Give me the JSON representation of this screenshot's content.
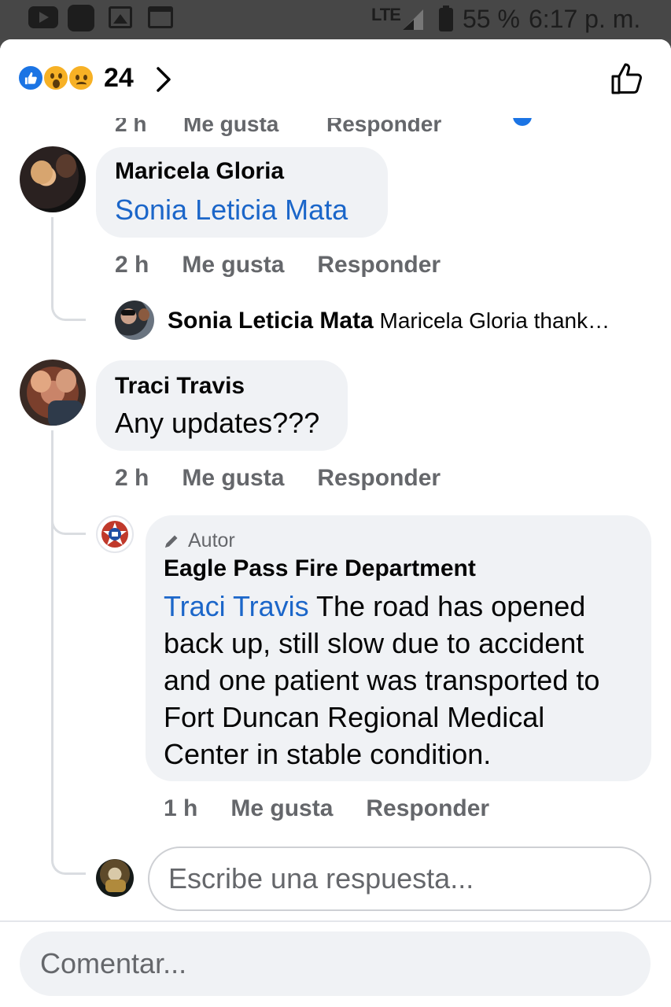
{
  "status_bar": {
    "network": "LTE",
    "battery": "55 %",
    "time": "6:17 p. m.",
    "icons": [
      "youtube-icon",
      "app-icon",
      "gallery-icon",
      "calendar-icon",
      "signal-icon",
      "battery-icon"
    ]
  },
  "reactions": {
    "count": "24",
    "types": [
      "like",
      "wow",
      "sad"
    ],
    "colors": {
      "like": "#1b74e4",
      "emoji": "#f7b125"
    }
  },
  "cut_off_row": {
    "time": "2 h",
    "like": "Me gusta",
    "reply": "Responder"
  },
  "comments": [
    {
      "author": "Maricela Gloria",
      "mention": "Sonia Leticia Mata",
      "text": "",
      "time": "2 h",
      "like": "Me gusta",
      "reply": "Responder",
      "reply_preview": {
        "author": "Sonia Leticia Mata",
        "text": "Maricela Gloria thank…"
      }
    },
    {
      "author": "Traci Travis",
      "text": "Any updates???",
      "time": "2 h",
      "like": "Me gusta",
      "reply": "Responder"
    }
  ],
  "author_reply": {
    "badge": "Autor",
    "author": "Eagle Pass Fire Department",
    "mention": "Traci Travis",
    "lines": [
      " The road has opened",
      "back up, still slow due to accident",
      "and one patient was transported to",
      "Fort Duncan Regional Medical",
      "Center in stable condition."
    ],
    "time": "1 h",
    "like": "Me gusta",
    "reply": "Responder"
  },
  "reply_input": {
    "placeholder": "Escribe una respuesta..."
  },
  "comment_input": {
    "placeholder": "Comentar..."
  },
  "colors": {
    "mention": "#1b66c9",
    "bubble": "#f0f2f5",
    "meta": "#65676b"
  }
}
